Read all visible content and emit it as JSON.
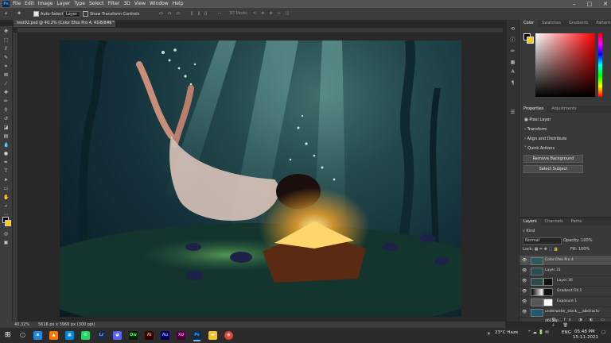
{
  "app": {
    "logo": "Ps"
  },
  "menu": {
    "items": [
      "File",
      "Edit",
      "Image",
      "Layer",
      "Type",
      "Select",
      "Filter",
      "3D",
      "View",
      "Window",
      "Help"
    ]
  },
  "window_controls": {
    "minimize": "–",
    "maximize": "□",
    "close": "✕"
  },
  "options": {
    "auto_select_label": "Auto-Select:",
    "auto_select_value": "Layer",
    "transform_label": "Show Transform Controls",
    "mode_label": "3D Mode:"
  },
  "document": {
    "tab_title": "test02.psd @ 40.2% (Color Efex Pro 4, RGB/8#) *",
    "close": "×"
  },
  "status": {
    "zoom": "40.32%",
    "info": "5616 px x 3960 px (300 ppi)"
  },
  "colors": {
    "foreground": "#000000",
    "background": "#ffcc00",
    "accent": "#31a8ff"
  },
  "color_panel": {
    "tabs": [
      "Color",
      "Swatches",
      "Gradients",
      "Patterns"
    ]
  },
  "properties": {
    "tabs": [
      "Properties",
      "Adjustments"
    ],
    "pixel_layer": "Pixel Layer",
    "sections": [
      "Transform",
      "Align and Distribute",
      "Quick Actions"
    ],
    "remove_bg": "Remove Background",
    "select_subject": "Select Subject"
  },
  "layers": {
    "tabs": [
      "Layers",
      "Channels",
      "Paths"
    ],
    "kind": "Kind",
    "blend": "Normal",
    "opacity_label": "Opacity:",
    "opacity_value": "100%",
    "lock_label": "Lock:",
    "fill_label": "Fill:",
    "fill_value": "100%",
    "items": [
      {
        "name": "Color Efex Pro 4",
        "selected": true
      },
      {
        "name": "Layer 31",
        "selected": false
      },
      {
        "name": "Layer 30",
        "selected": false
      },
      {
        "name": "Gradient Fill 1",
        "selected": false
      },
      {
        "name": "Exposure 1",
        "selected": false
      },
      {
        "name": "underwater_stock___abstracts-d6E5iqr...",
        "selected": false
      }
    ]
  },
  "taskbar": {
    "apps": [
      "Ai",
      "Xd",
      "Dw",
      "Ps",
      "Lr",
      "Au"
    ],
    "weather": "23°C Haze",
    "lang": "ENG",
    "time": "05:48 PM",
    "date": "15-11-2021"
  }
}
